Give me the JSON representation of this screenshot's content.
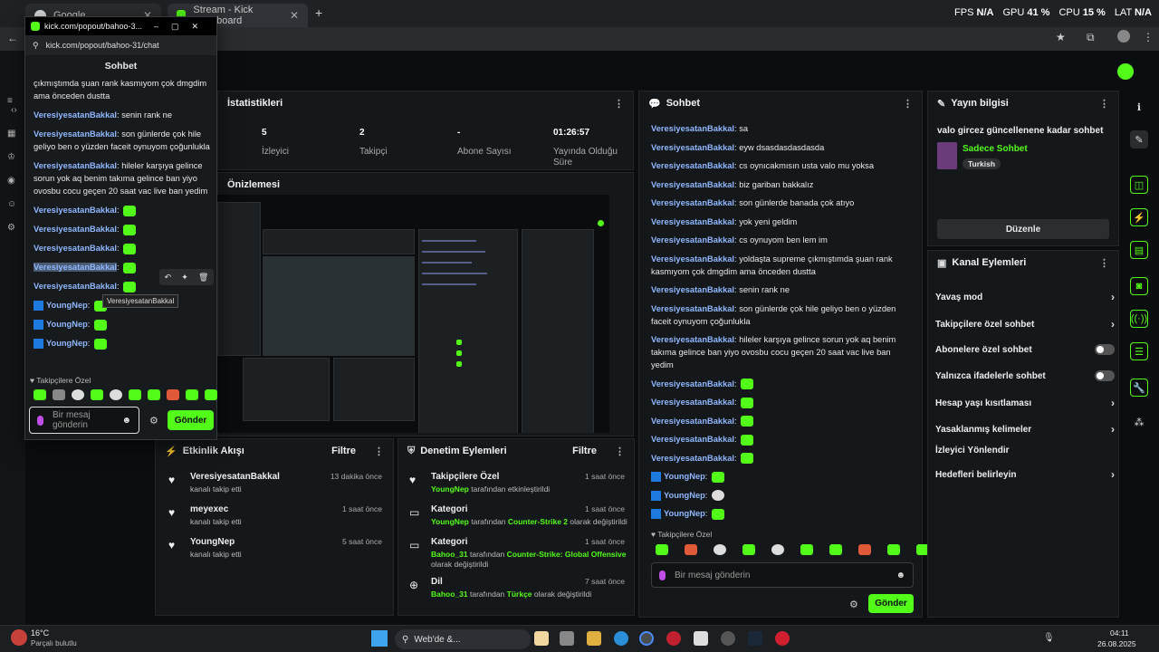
{
  "tabs": [
    {
      "title": "Google"
    },
    {
      "title": "Stream - Kick Dashboard"
    }
  ],
  "overlay": {
    "fps_label": "FPS",
    "fps_value": "N/A",
    "gpu_label": "GPU",
    "gpu_value": "41 %",
    "cpu_label": "CPU",
    "cpu_value": "15 %",
    "lat_label": "LAT",
    "lat_value": "N/A"
  },
  "popout": {
    "title": "kick.com/popout/bahoo-3...",
    "url": "kick.com/popout/bahoo-31/chat",
    "header": "Sohbet",
    "messages": [
      {
        "user": "",
        "text": "çıkmıştımda şuan rank kasmıyom çok dmgdim ama önceden dustta"
      },
      {
        "user": "VeresiyesatanBakkal",
        "text": "senin rank ne"
      },
      {
        "user": "VeresiyesatanBakkal",
        "text": "son günlerde çok hile geliyo ben o yüzden faceit oynuyom çoğunlukla"
      },
      {
        "user": "VeresiyesatanBakkal",
        "text": "hileler karşıya gelince sorun yok aq benim takıma gelince ban yiyo ovosbu cocu geçen 20 saat vac live ban yedim"
      },
      {
        "user": "VeresiyesatanBakkal",
        "text": ""
      },
      {
        "user": "VeresiyesatanBakkal",
        "text": ""
      },
      {
        "user": "VeresiyesatanBakkal",
        "text": ""
      },
      {
        "user": "VeresiyesatanBakkal",
        "text": ""
      },
      {
        "user": "VeresiyesatanBakkal",
        "text": ""
      },
      {
        "user": "YoungNep",
        "text": ""
      },
      {
        "user": "YoungNep",
        "text": ""
      },
      {
        "user": "YoungNep",
        "text": ""
      }
    ],
    "tooltip": "VeresiyesatanBakkal",
    "emote_label": "Takipçilere Özel",
    "input_placeholder": "Bir mesaj gönderin",
    "send": "Gönder"
  },
  "stats": {
    "title": "İstatistikleri",
    "items": [
      {
        "value": "5",
        "label": "İzleyici"
      },
      {
        "value": "2",
        "label": "Takipçi"
      },
      {
        "value": "-",
        "label": "Abone Sayısı"
      },
      {
        "value": "01:26:57",
        "label": "Yayında Olduğu Süre"
      }
    ]
  },
  "preview": {
    "title": "Önizlemesi"
  },
  "chat": {
    "title": "Sohbet",
    "messages": [
      {
        "user": "VeresiyesatanBakkal",
        "text": "sa"
      },
      {
        "user": "VeresiyesatanBakkal",
        "text": "eyw dsasdasdasdasda"
      },
      {
        "user": "VeresiyesatanBakkal",
        "text": "cs oynıcakmısın usta valo mu yoksa"
      },
      {
        "user": "VeresiyesatanBakkal",
        "text": "biz gariban bakkalız"
      },
      {
        "user": "VeresiyesatanBakkal",
        "text": "son günlerde banada çok atıyo"
      },
      {
        "user": "VeresiyesatanBakkal",
        "text": "yok yeni geldim"
      },
      {
        "user": "VeresiyesatanBakkal",
        "text": "cs oynuyom ben lem im"
      },
      {
        "user": "VeresiyesatanBakkal",
        "text": "yoldaşta supreme çıkmıştımda şuan rank kasmıyom çok dmgdim ama önceden dustta"
      },
      {
        "user": "VeresiyesatanBakkal",
        "text": "senin rank ne"
      },
      {
        "user": "VeresiyesatanBakkal",
        "text": "son günlerde çok hile geliyo ben o yüzden faceit oynuyom çoğunlukla"
      },
      {
        "user": "VeresiyesatanBakkal",
        "text": "hileler karşıya gelince sorun yok aq benim takıma gelince ban yiyo ovosbu cocu geçen 20 saat vac live ban yedim"
      }
    ],
    "emote_users": [
      "VeresiyesatanBakkal",
      "VeresiyesatanBakkal",
      "VeresiyesatanBakkal",
      "VeresiyesatanBakkal",
      "VeresiyesatanBakkal"
    ],
    "young_users": [
      "YoungNep",
      "YoungNep",
      "YoungNep"
    ],
    "emote_label": "Takipçilere Özel",
    "input_placeholder": "Bir mesaj gönderin",
    "send": "Gönder"
  },
  "stream_info": {
    "title": "Yayın bilgisi",
    "stream_title": "valo gircez güncellenene kadar sohbet",
    "category": "Sadece Sohbet",
    "tag": "Turkish",
    "edit": "Düzenle"
  },
  "channel_actions": {
    "title": "Kanal Eylemleri",
    "items": [
      {
        "label": "Yavaş mod",
        "kind": "chevron"
      },
      {
        "label": "Takipçilere özel sohbet",
        "kind": "chevron"
      },
      {
        "label": "Abonelere özel sohbet",
        "kind": "toggle"
      },
      {
        "label": "Yalnızca ifadelerle sohbet",
        "kind": "toggle"
      },
      {
        "label": "Hesap yaşı kısıtlaması",
        "kind": "chevron"
      },
      {
        "label": "Yasaklanmış kelimeler",
        "kind": "chevron"
      },
      {
        "label": "İzleyici Yönlendir",
        "kind": "none"
      },
      {
        "label": "Hedefleri belirleyin",
        "kind": "chevron"
      }
    ]
  },
  "activity": {
    "title": "Etkinlik Akışı",
    "filter": "Filtre",
    "items": [
      {
        "name": "VeresiyesatanBakkal",
        "sub": "kanalı takip etti",
        "time": "13 dakika önce"
      },
      {
        "name": "meyexec",
        "sub": "kanalı takip etti",
        "time": "1 saat önce"
      },
      {
        "name": "YoungNep",
        "sub": "kanalı takip etti",
        "time": "5 saat önce"
      }
    ]
  },
  "moderation": {
    "title": "Denetim Eylemleri",
    "filter": "Filtre",
    "items": [
      {
        "name": "Takipçilere Özel",
        "time": "1 saat önce",
        "actor": "YoungNep",
        "middle": "tarafından etkinleştirildi",
        "target": "",
        "tail": ""
      },
      {
        "name": "Kategori",
        "time": "1 saat önce",
        "actor": "YoungNep",
        "middle": "tarafından",
        "target": "Counter-Strike 2",
        "tail": "olarak değiştirildi"
      },
      {
        "name": "Kategori",
        "time": "1 saat önce",
        "actor": "Bahoo_31",
        "middle": "tarafından",
        "target": "Counter-Strike: Global Offensive",
        "tail": "olarak değiştirildi"
      },
      {
        "name": "Dil",
        "time": "7 saat önce",
        "actor": "Bahoo_31",
        "middle": "tarafından",
        "target": "Türkçe",
        "tail": "olarak değiştirildi"
      }
    ]
  },
  "taskbar": {
    "weather_temp": "16°C",
    "weather_desc": "Parçalı bulutlu",
    "search": "Web'de &...",
    "time": "04:11",
    "date": "26.08.2025"
  },
  "colors": {
    "accent": "#53fc18",
    "username": "#8fb7ff"
  }
}
